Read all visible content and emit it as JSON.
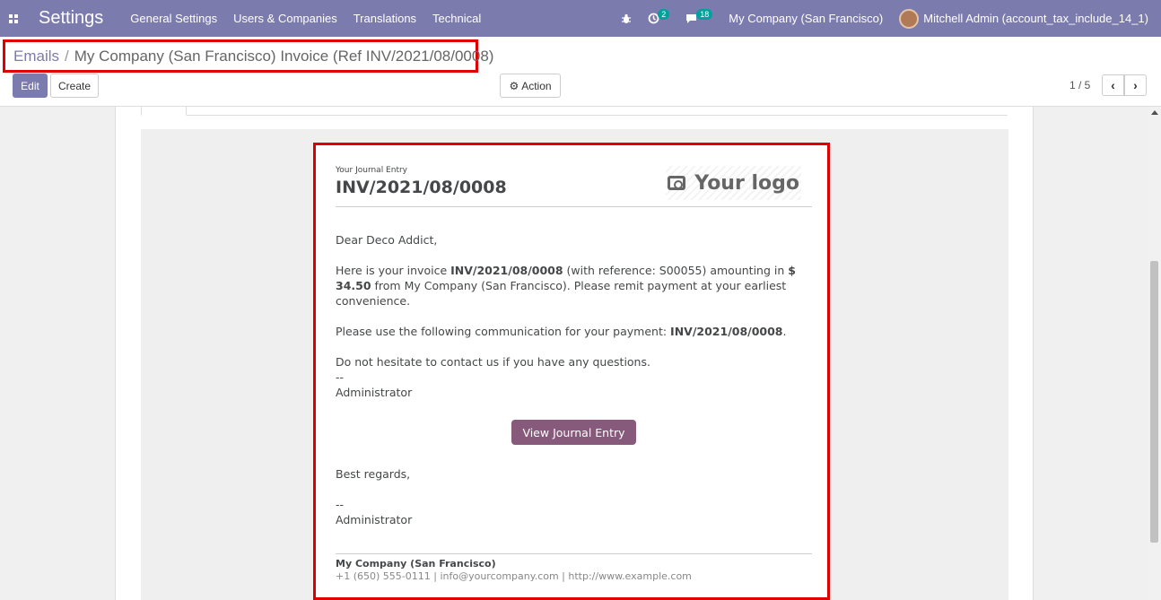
{
  "navbar": {
    "app_name": "Settings",
    "menu": [
      "General Settings",
      "Users & Companies",
      "Translations",
      "Technical"
    ],
    "activity_count": "2",
    "message_count": "18",
    "company": "My Company (San Francisco)",
    "user": "Mitchell Admin (account_tax_include_14_1)"
  },
  "breadcrumb": {
    "parent": "Emails",
    "separator": "/",
    "current": "My Company (San Francisco) Invoice (Ref INV/2021/08/0008)"
  },
  "buttons": {
    "edit": "Edit",
    "create": "Create",
    "action": "Action"
  },
  "pager": {
    "value": "1 / 5"
  },
  "email": {
    "subtitle": "Your Journal Entry",
    "number": "INV/2021/08/0008",
    "logo_text": "Your logo",
    "greeting": "Dear Deco Addict,",
    "para1_a": "Here is your invoice ",
    "para1_invoice": "INV/2021/08/0008",
    "para1_b": " (with reference: S00055) amounting in ",
    "para1_amount": "$ 34.50",
    "para1_c": " from My Company (San Francisco). Please remit payment at your earliest convenience.",
    "para2_a": "Please use the following communication for your payment: ",
    "para2_ref": "INV/2021/08/0008",
    "para2_b": ".",
    "para3": "Do not hesitate to contact us if you have any questions.",
    "sig_dash": "--",
    "sig_name": "Administrator",
    "button": "View Journal Entry",
    "regards": "Best regards,",
    "sig2_dash": "--",
    "sig2_name": "Administrator",
    "footer_company": "My Company (San Francisco)",
    "footer_contact": "+1 (650) 555-0111 | info@yourcompany.com | http://www.example.com"
  },
  "colors": {
    "navbar": "#7c7bad",
    "highlight_border": "#e00000",
    "email_button": "#875a7b",
    "badge": "#00a09d"
  }
}
